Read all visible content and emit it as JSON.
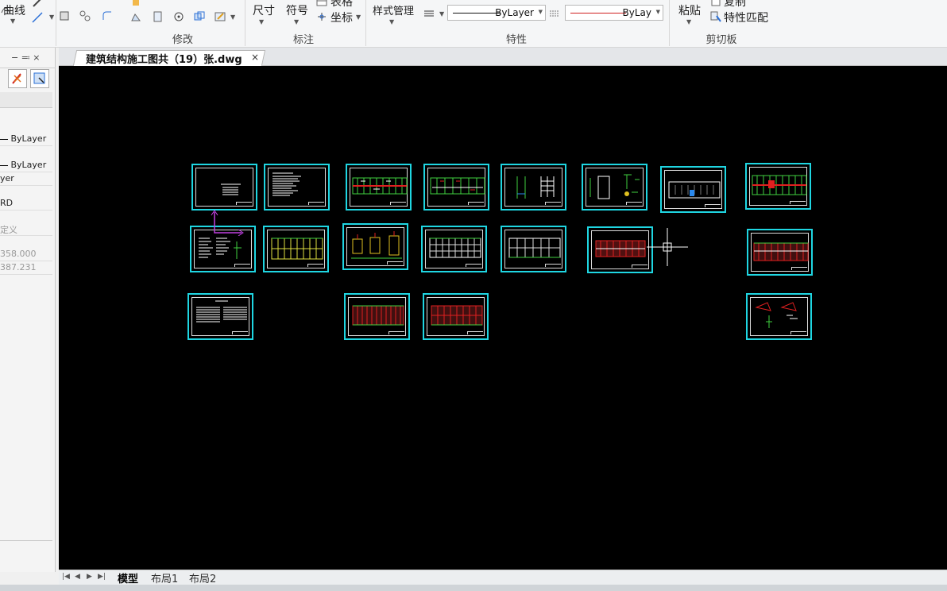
{
  "ribbon": {
    "draw_curve_label": "曲线",
    "modify_group": "修改",
    "dim_label": "尺寸",
    "symbol_label": "符号",
    "table_label": "表格",
    "coord_label": "坐标",
    "annotate_group": "标注",
    "style_mgr_label": "样式管理",
    "linetype_value": "ByLayer",
    "color_value": "ByLay",
    "properties_group": "特性",
    "paste_label": "粘贴",
    "copy_label": "复制",
    "match_props_label": "特性匹配",
    "clipboard_group": "剪切板"
  },
  "left_panel": {
    "pin_glyph": "−  ≕  ×",
    "rows": [
      "ByLayer",
      "ByLayer",
      "yer",
      "RD",
      "定义",
      "358.000",
      "387.231"
    ]
  },
  "document": {
    "tab_title": "建筑结构施工图共（19）张.dwg",
    "close_glyph": "×"
  },
  "layouts": {
    "model": "模型",
    "layout1": "布局1",
    "layout2": "布局2"
  },
  "colors": {
    "sheet_border": "#1fd6e2",
    "canvas_bg": "#000000",
    "red": "#e02020",
    "green": "#40d040",
    "ucs": "#c040e0"
  }
}
